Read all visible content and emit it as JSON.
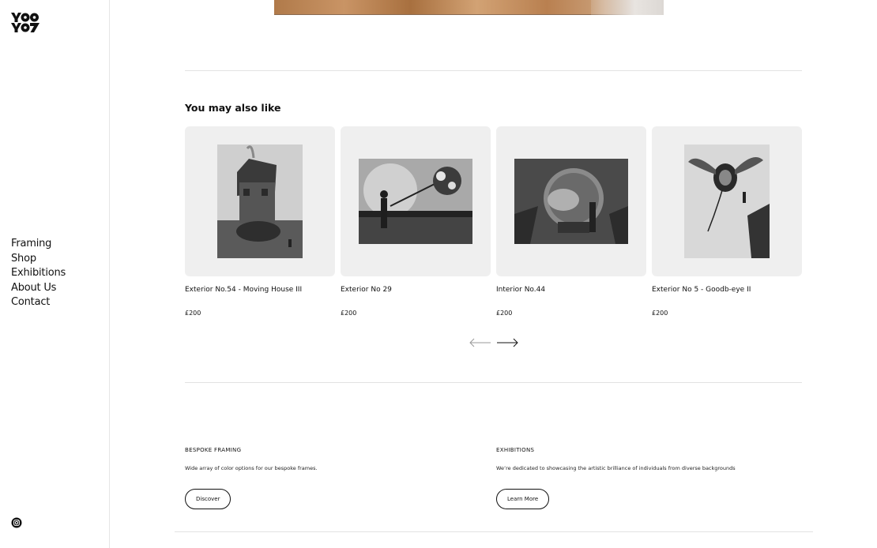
{
  "brand": {
    "logo_alt": "yoo yoy"
  },
  "nav": {
    "items": [
      {
        "label": "Framing"
      },
      {
        "label": "Shop"
      },
      {
        "label": "Exhibitions"
      },
      {
        "label": "About Us"
      },
      {
        "label": "Contact"
      }
    ]
  },
  "related": {
    "title": "You may also like",
    "products": [
      {
        "name": "Exterior No.54 - Moving House III",
        "price": "£200"
      },
      {
        "name": "Exterior No 29",
        "price": "£200"
      },
      {
        "name": "Interior No.44",
        "price": "£200"
      },
      {
        "name": "Exterior No 5 - Goodb-eye II",
        "price": "£200"
      }
    ]
  },
  "promos": [
    {
      "title": "BESPOKE FRAMING",
      "description": "Wide array of color options for our bespoke frames.",
      "button": "Discover"
    },
    {
      "title": "EXHIBITIONS",
      "description": "We’re dedicated to showcasing the artistic brilliance of individuals from diverse backgrounds",
      "button": "Learn More"
    }
  ],
  "icons": {
    "instagram": "instagram-icon",
    "prev": "arrow-left-icon",
    "next": "arrow-right-icon"
  },
  "colors": {
    "thumb_bg": "#efefef",
    "text": "#111111",
    "divider": "#e2e2e2"
  }
}
